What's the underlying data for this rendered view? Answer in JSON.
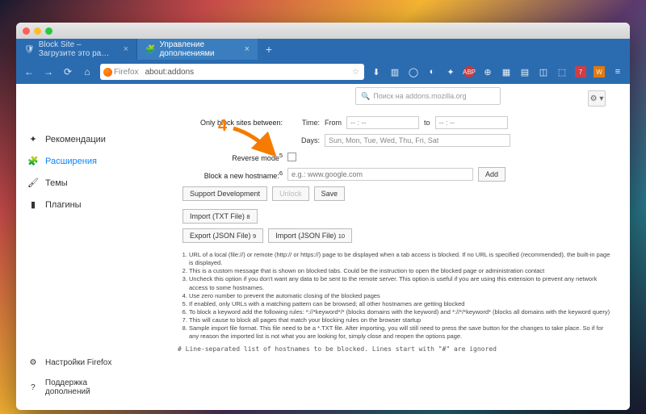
{
  "tabs": [
    {
      "title": "Block Site – Загрузите это ра…"
    },
    {
      "title": "Управление дополнениями"
    }
  ],
  "url": {
    "prefix": "Firefox",
    "path": "about:addons"
  },
  "search": {
    "placeholder": "Поиск на addons.mozilla.org"
  },
  "sidebar": {
    "items": [
      {
        "icon": "✦",
        "label": "Рекомендации"
      },
      {
        "icon": "🧩",
        "label": "Расширения"
      },
      {
        "icon": "🖌",
        "label": "Темы"
      },
      {
        "icon": "▮",
        "label": "Плагины"
      }
    ],
    "footer": [
      {
        "icon": "⚙",
        "label": "Настройки Firefox"
      },
      {
        "icon": "?",
        "label": "Поддержка дополнений"
      }
    ]
  },
  "annotation": {
    "number": "4"
  },
  "form": {
    "only_block_label": "Only block sites between:",
    "time_label": "Time:",
    "from_label": "From",
    "from_val": "-- : --",
    "to_label": "to",
    "to_val": "-- : --",
    "days_label": "Days:",
    "days_val": "Sun, Mon, Tue, Wed, Thu, Fri, Sat",
    "reverse_label": "Reverse mode",
    "reverse_sup": "5",
    "block_label": "Block a new hostname:",
    "block_sup": "6",
    "block_ph": "e.g.: www.google.com",
    "add": "Add",
    "support": "Support Development",
    "unlock": "Unlock",
    "save": "Save",
    "import_txt": "Import (TXT File)",
    "import_txt_sup": "8",
    "export_json": "Export (JSON File)",
    "export_json_sup": "9",
    "import_json": "Import (JSON File)",
    "import_json_sup": "10"
  },
  "footnotes": [
    "URL of a local (file://) or remote (http:// or https://) page to be displayed when a tab access is blocked. If no URL is specified (recommended), the built-in page is displayed.",
    "This is a custom message that is shown on blocked tabs. Could be the instruction to open the blocked page or administration contact",
    "Uncheck this option if you don't want any data to be sent to the remote server. This option is useful if you are using this extension to prevent any network access to some hostnames.",
    "Use zero number to prevent the automatic closing of the blocked pages",
    "If enabled, only URLs with a matching pattern can be browsed; all other hostnames are getting blocked",
    "To block a keyword add the following rules: *://*keyword*/* (blocks domains with the keyword) and *://*/*keyword* (blocks all domains with the keyword query)",
    "This will cause to block all pages that match your blocking rules on the browser startup",
    "Sample import file format. This file need to be a *.TXT file. After importing, you will still need to press the save button for the changes to take place. So if for any reason the imported list is not what you are looking for, simply close and reopen the options page."
  ],
  "codeline": "# Line-separated list of hostnames to be blocked. Lines start with \"#\" are ignored"
}
